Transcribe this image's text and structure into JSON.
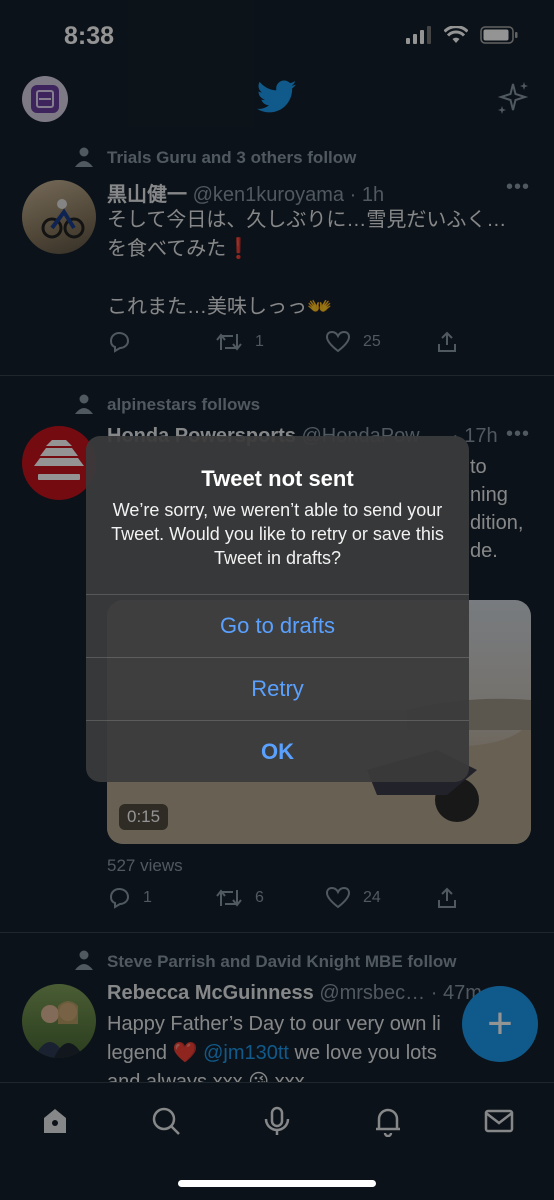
{
  "status_bar": {
    "time": "8:38"
  },
  "feed": [
    {
      "social_context": "Trials Guru and 3 others follow",
      "name": "黒山健一",
      "handle": "@ken1kuroyama",
      "meta": "· 1h",
      "text_lines": [
        "そして今日は、久しぶりに…雪見だいふく…",
        "を食べてみた❗",
        "",
        "これまた…美味しっっ👐"
      ],
      "replies": "",
      "retweets": "1",
      "likes": "25"
    },
    {
      "social_context": "alpinestars follows",
      "name": "Honda Powersports",
      "handle": "@HondaPow",
      "meta": "· 17h",
      "text_fragments": [
        "to",
        "ning",
        "dition,",
        "de."
      ],
      "video_time": "0:15",
      "views": "527 views",
      "replies": "1",
      "retweets": "6",
      "likes": "24"
    },
    {
      "social_context": "Steve Parrish and David Knight MBE follow",
      "name": "Rebecca McGuinness",
      "handle": "@mrsbec…",
      "meta": "· 47m",
      "text_line1": "Happy Father’s Day to our very own li",
      "text_line2_a": "legend",
      "text_line2_mention": "@jm130tt",
      "text_line2_b": "we love you lots",
      "text_line3": "and always xxx",
      "text_line3_b": "xxx"
    }
  ],
  "alert": {
    "title": "Tweet not sent",
    "message": "We’re sorry, we weren’t able to send your Tweet. Would you like to retry or save this Tweet in drafts?",
    "buttons": {
      "drafts": "Go to drafts",
      "retry": "Retry",
      "ok": "OK"
    }
  },
  "colors": {
    "accent": "#1d9bf0",
    "background": "#15202b",
    "alert_button": "#5aa1ff"
  },
  "icons": [
    "profile-avatar",
    "twitter-bird-icon",
    "sparkle-icon",
    "reply-icon",
    "retweet-icon",
    "like-icon",
    "share-icon",
    "home-icon",
    "search-icon",
    "spaces-icon",
    "notifications-icon",
    "messages-icon",
    "compose-icon"
  ]
}
